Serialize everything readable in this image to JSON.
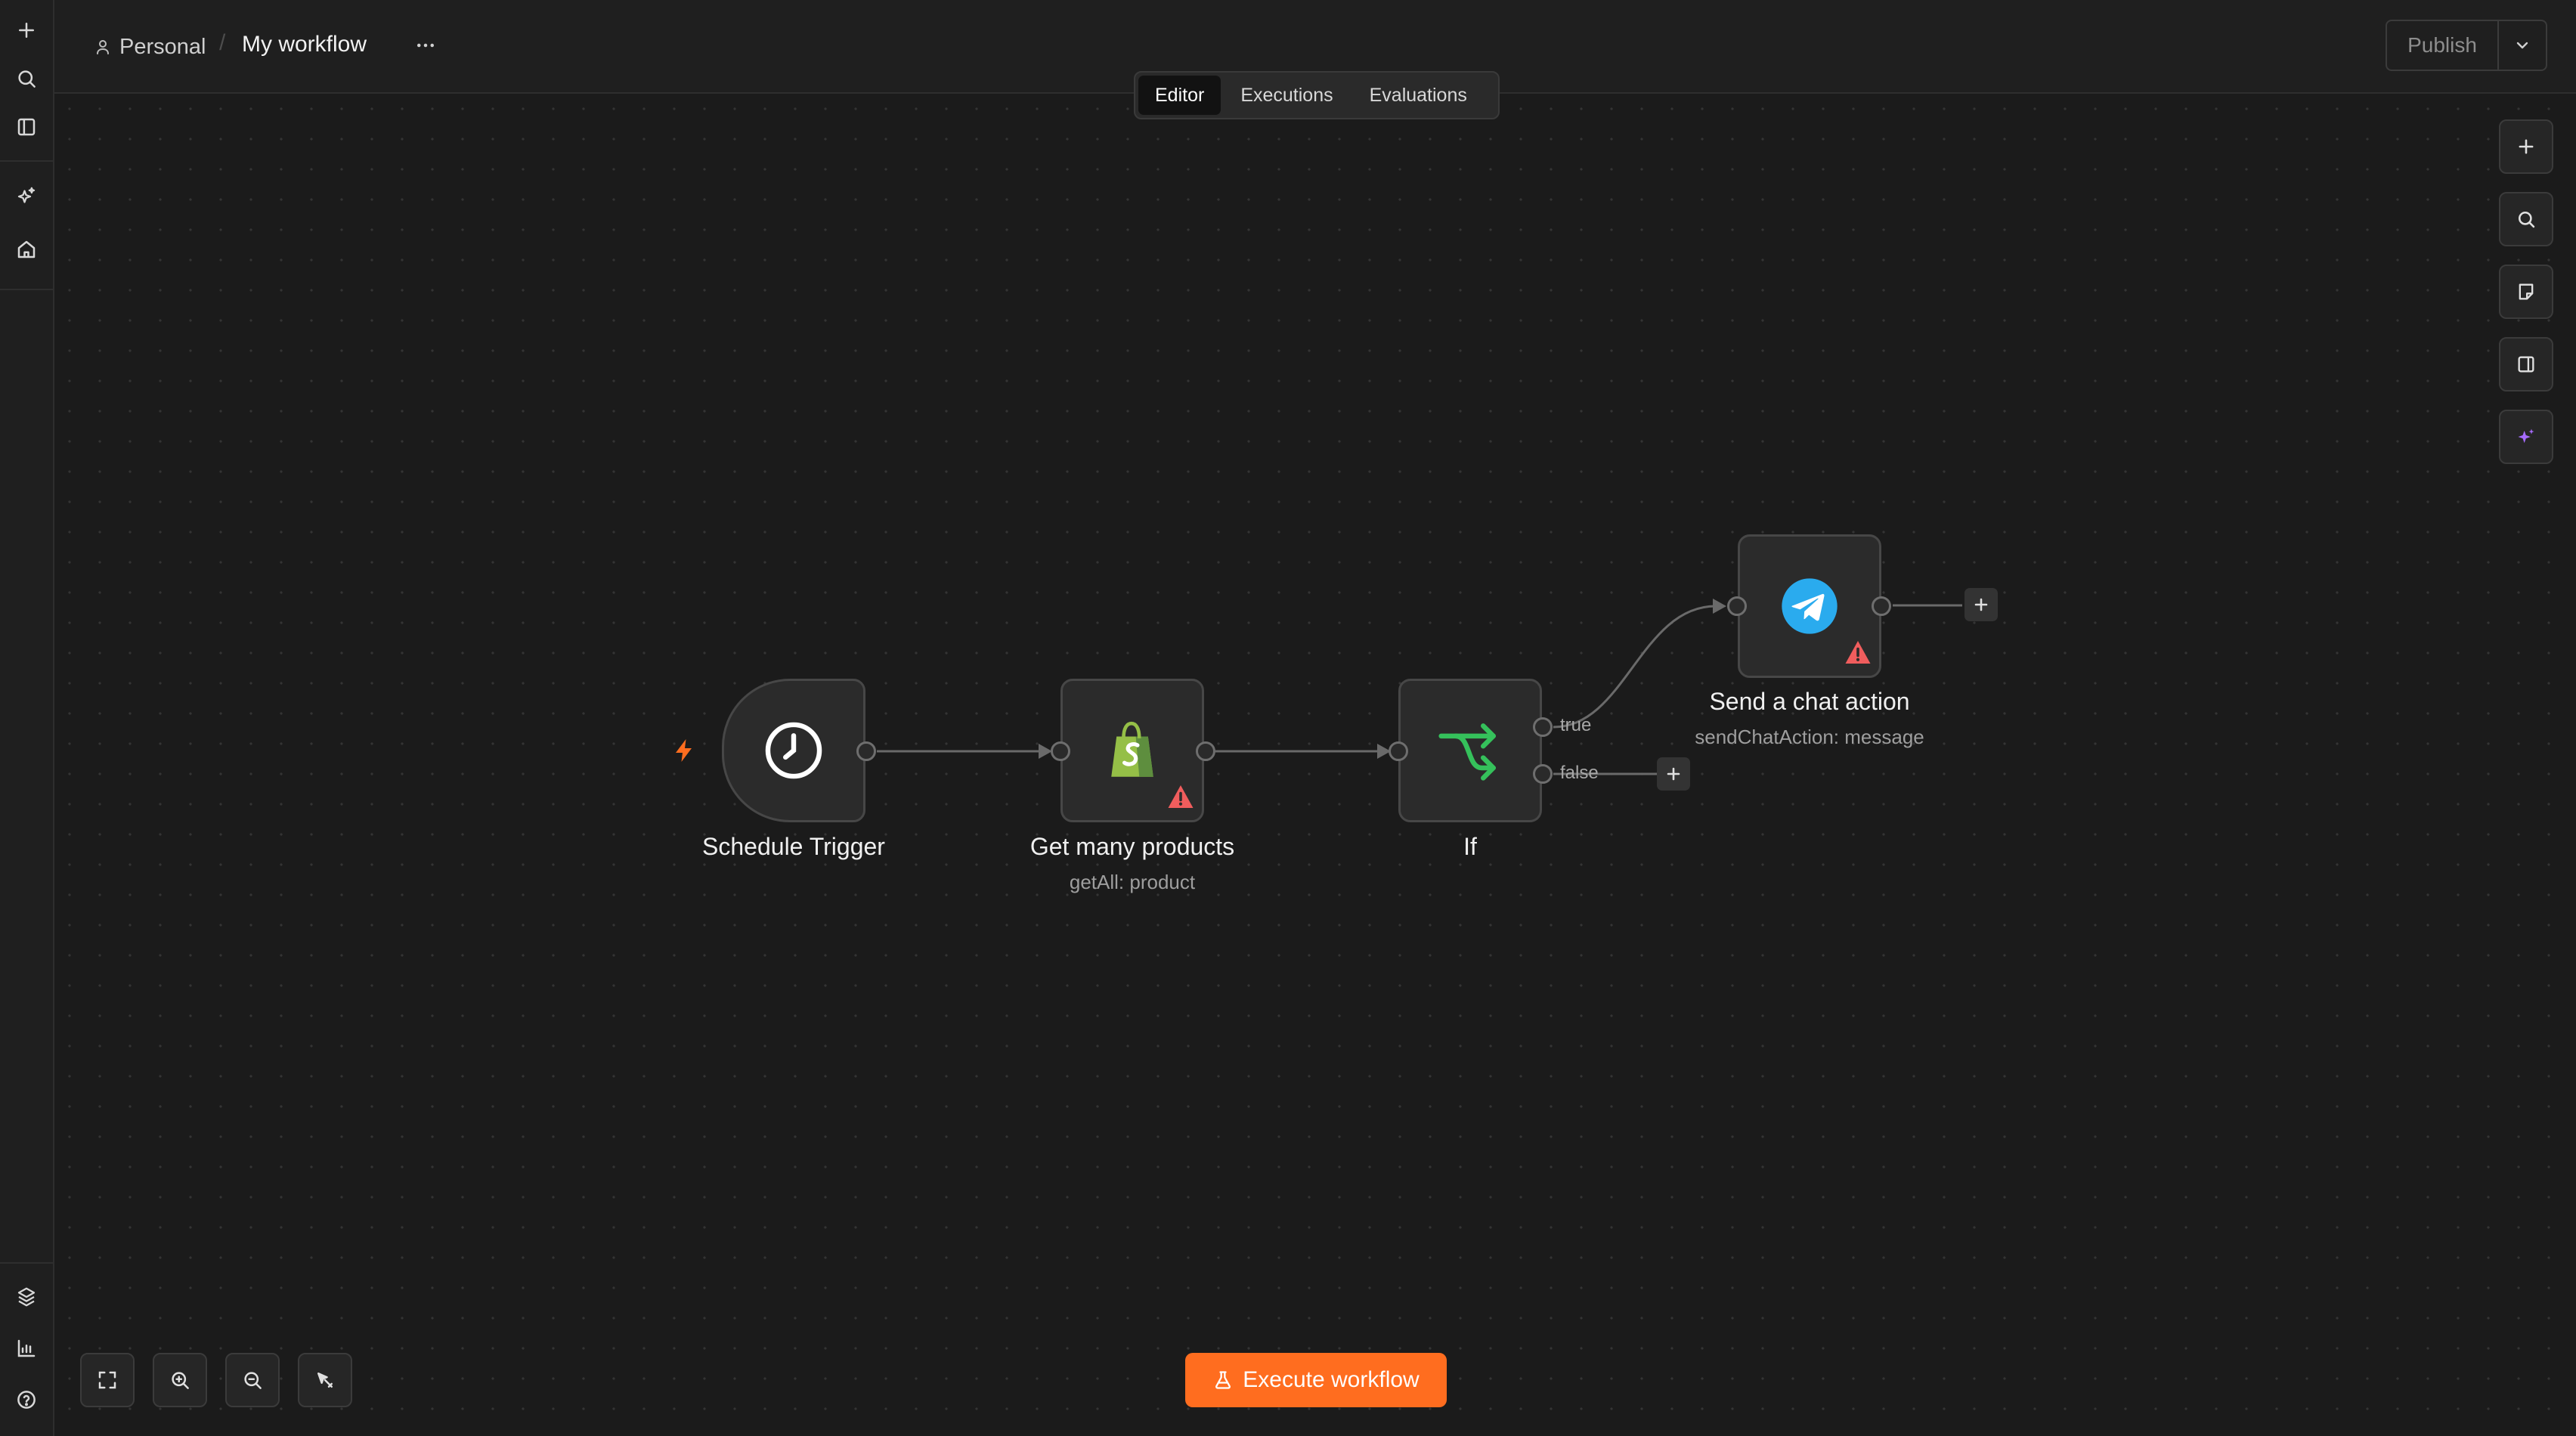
{
  "header": {
    "project": "Personal",
    "separator": "/",
    "workflow_name": "My workflow",
    "tabs": [
      {
        "label": "Editor",
        "active": true
      },
      {
        "label": "Executions",
        "active": false
      },
      {
        "label": "Evaluations",
        "active": false
      }
    ],
    "publish_label": "Publish"
  },
  "sidebar": {
    "top_icons": [
      "plus-icon",
      "search-icon",
      "panel-icon"
    ],
    "middle_icons": [
      "sparkles-icon",
      "home-icon"
    ],
    "bottom_icons": [
      "templates-icon",
      "insights-icon",
      "help-icon"
    ]
  },
  "nodes": {
    "schedule_trigger": {
      "label": "Schedule Trigger",
      "icon": "clock-icon"
    },
    "get_products": {
      "label": "Get many products",
      "subtitle": "getAll: product",
      "icon": "shopify-icon",
      "warning": true
    },
    "if_node": {
      "label": "If",
      "icon": "branch-icon",
      "true_label": "true",
      "false_label": "false"
    },
    "send_chat": {
      "label": "Send a chat action",
      "subtitle": "sendChatAction: message",
      "icon": "telegram-icon",
      "warning": true
    }
  },
  "right_toolbar": [
    "plus-icon",
    "search-icon",
    "sticky-note-icon",
    "panel-icon",
    "ai-sparkle-icon"
  ],
  "canvas_controls": [
    "fit-view-icon",
    "zoom-in-icon",
    "zoom-out-icon",
    "tidy-up-icon"
  ],
  "execute_label": "Execute workflow",
  "colors": {
    "accent_orange": "#ff6d1f",
    "warning_red": "#f05d5d",
    "shopify_green": "#95bf47",
    "if_green": "#35c15b",
    "telegram_blue": "#2aabee",
    "ai_purple": "#a66cff"
  }
}
